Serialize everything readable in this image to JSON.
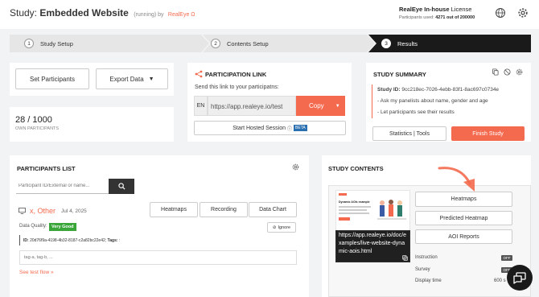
{
  "header": {
    "title_prefix": "Study:",
    "title_name": "Embedded Website",
    "status": "(running) by",
    "brand": "RealEye Ω",
    "license_name": "RealEye In-house",
    "license_suffix": "License",
    "participants_used_label": "Participants used:",
    "participants_used_value": "4271 out of 200000"
  },
  "steps": [
    {
      "num": "1",
      "label": "Study Setup"
    },
    {
      "num": "2",
      "label": "Contents Setup"
    },
    {
      "num": "3",
      "label": "Results"
    }
  ],
  "actions": {
    "set_participants": "Set Participants",
    "export_data": "Export Data"
  },
  "participants_count": {
    "value": "28 / 1000",
    "label": "OWN PARTICIPANTS"
  },
  "participation": {
    "title": "PARTICIPATION LINK",
    "subtitle": "Send this link to your participatns:",
    "lang": "EN",
    "url": "https://app.realeye.io/test",
    "copy": "Copy",
    "hosted": "Start Hosted Session",
    "beta": "BETA"
  },
  "summary": {
    "title": "STUDY SUMMARY",
    "study_id_label": "Study ID:",
    "study_id": "9cc218ec-7026-4ebb-83f1-8ac697c0734e",
    "notes": [
      "- Ask my panelists about name, gender and age",
      "- Let participants see their results"
    ],
    "stats_button": "Statistics | Tools",
    "finish_button": "Finish Study"
  },
  "participants_list": {
    "title": "PARTICIPANTS LIST",
    "search_placeholder": "Participant ID/External or name...",
    "participant_name": "x, Other",
    "participant_date": "Jul 4, 2025",
    "buttons": [
      "Heatmaps",
      "Recording",
      "Data Chart"
    ],
    "quality_label": "Data Quality:",
    "quality_value": "Very Good",
    "ignore": "Ignore",
    "id_label": "ID:",
    "id_value": "20d76f9a-4198-4b32-8187-c2a82bc22e42;",
    "tags_label": "Tags:",
    "tags_value": ":",
    "tags_input": "tag-a, tag-b, ...",
    "see_test_flow": "See test flow »"
  },
  "study_contents": {
    "title": "STUDY CONTENTS",
    "url_overlay": "https://app.realeye.io/doc/examples/live-website-dynamic-aois.html",
    "thumb_heading": "Dynamic AOIs example",
    "buttons": [
      "Heatmaps",
      "Predicted Heatmap",
      "AOI Reports"
    ],
    "rows": [
      {
        "label": "Instruction",
        "value": "OFF"
      },
      {
        "label": "Survey",
        "value": "OFF"
      },
      {
        "label": "Display time",
        "value": "600 s"
      }
    ]
  },
  "colors": {
    "accent": "#f46a4e",
    "dark_step": "#1a1a1a",
    "good": "#3aa63a"
  }
}
